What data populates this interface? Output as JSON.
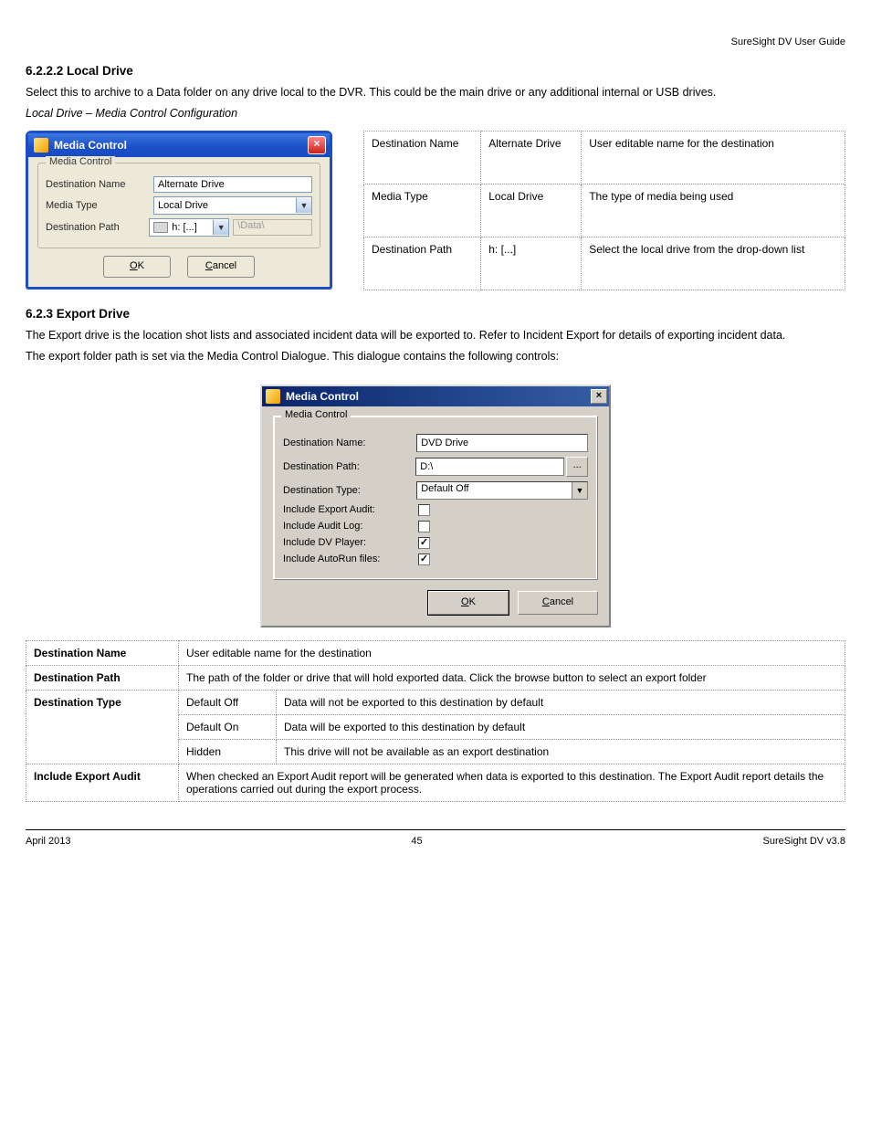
{
  "page": {
    "header": "SureSight DV User Guide",
    "section1_title": "6.2.2.2 Local Drive",
    "section1_p1": "Select this to archive to a Data folder on any drive local to the DVR. This could be the main drive or any additional internal or USB drives.",
    "section1_p2": "Local Drive – Media Control Configuration",
    "section2_title": "6.2.3 Export Drive",
    "section2_p1": "The Export drive is the location shot lists and associated incident data will be exported to. Refer to Incident Export for details of exporting incident data.",
    "section2_p2": "The export folder path is set via the Media Control Dialogue. This dialogue contains the following controls:"
  },
  "dialog1": {
    "title": "Media Control",
    "group_legend": "Media Control",
    "row1_label": "Destination Name",
    "row1_value": "Alternate Drive",
    "row2_label": "Media Type",
    "row2_value": "Local Drive",
    "row3_label": "Destination Path",
    "row3_drive": "h: [...]",
    "row3_disabled": "\\Data\\",
    "ok": "OK",
    "cancel": "Cancel"
  },
  "dialog1_table": {
    "r1c1": "Destination Name",
    "r1c2": "Alternate Drive",
    "r1c3": "User editable name for the destination",
    "r2c1": "Media Type",
    "r2c2": "Local Drive",
    "r2c3": "The type of media being used",
    "r3c1": "Destination Path",
    "r3c2": "h: [...]",
    "r3c3": "Select the local drive from the drop-down list"
  },
  "dialog2": {
    "title": "Media Control",
    "group_legend": "Media Control",
    "dest_name_label": "Destination Name:",
    "dest_name_value": "DVD Drive",
    "dest_path_label": "Destination Path:",
    "dest_path_value": "D:\\",
    "browse": "...",
    "dest_type_label": "Destination Type:",
    "dest_type_value": "Default Off",
    "inc_export_audit_label": "Include Export Audit:",
    "inc_export_audit_checked": false,
    "inc_audit_log_label": "Include Audit Log:",
    "inc_audit_log_checked": false,
    "inc_dv_player_label": "Include DV Player:",
    "inc_dv_player_checked": true,
    "inc_autorun_label": "Include AutoRun files:",
    "inc_autorun_checked": true,
    "ok": "OK",
    "cancel": "Cancel"
  },
  "expl": {
    "dest_name_lbl": "Destination Name",
    "dest_name_txt": "User editable name for the destination",
    "dest_path_lbl": "Destination Path",
    "dest_path_txt": "The path of the folder or drive that will hold exported data. Click the browse button to select an export folder",
    "dest_type_lbl": "Destination Type",
    "dt_off_lbl": "Default Off",
    "dt_off_txt": "Data will not be exported to this destination by default",
    "dt_on_lbl": "Default On",
    "dt_on_txt": "Data will be exported to this destination by default",
    "dt_hidden_lbl": "Hidden",
    "dt_hidden_txt": "This drive will not be available as an export destination",
    "inc_export_lbl": "Include Export Audit",
    "inc_export_txt": "When checked an Export Audit report will be generated when data is exported to this destination. The Export Audit report details the operations carried out during the export process."
  },
  "footer": {
    "left": "April 2013",
    "center": "45",
    "right": "SureSight DV v3.8"
  }
}
